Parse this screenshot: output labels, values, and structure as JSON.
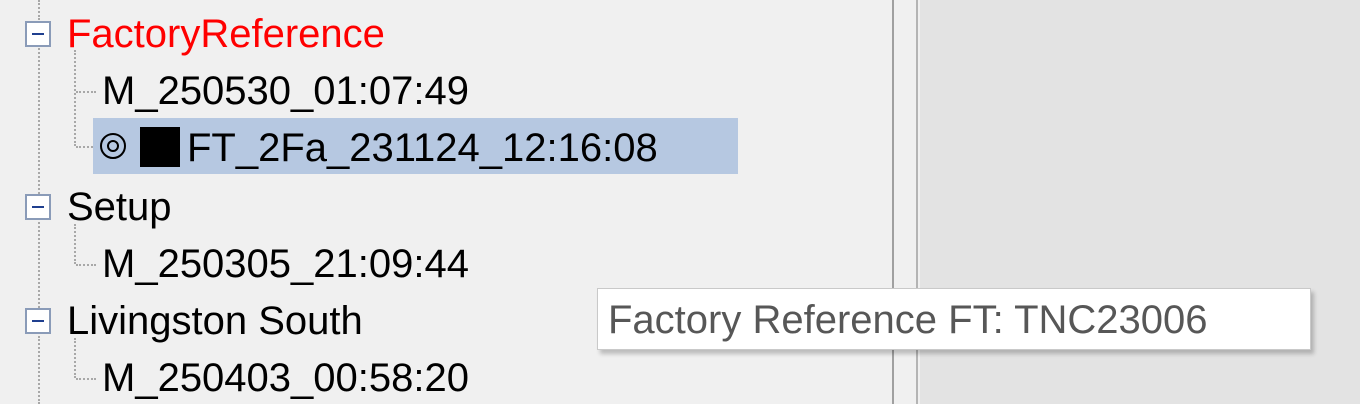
{
  "tree": {
    "groups": [
      {
        "label": "FactoryReference",
        "color": "#ff0000",
        "children": [
          {
            "label": "M_250530_01:07:49"
          },
          {
            "label": "FT_2Fa_231124_12:16:08",
            "selected": true,
            "icons": [
              "target-icon",
              "black-square-icon"
            ]
          }
        ]
      },
      {
        "label": "Setup",
        "children": [
          {
            "label": "M_250305_21:09:44"
          }
        ]
      },
      {
        "label": "Livingston South",
        "children": [
          {
            "label": "M_250403_00:58:20"
          }
        ]
      }
    ]
  },
  "tooltip": {
    "text": "Factory Reference FT: TNC23006"
  },
  "colors": {
    "selection": "#b6c8e1",
    "highlight_text": "#ff0000",
    "expander_border": "#8a9bb8"
  }
}
